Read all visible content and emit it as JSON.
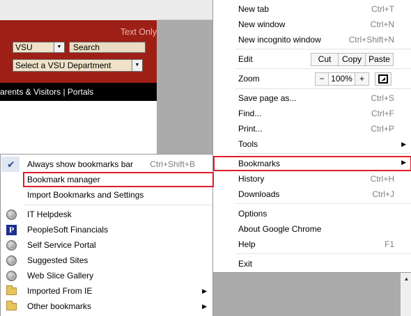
{
  "webpage": {
    "text_only": "Text Only",
    "campus_select": "VSU",
    "search_placeholder": "Search",
    "department_select": "Select a VSU Department",
    "nav_bar": "arents & Visitors | Portals"
  },
  "main_menu": {
    "new_tab": {
      "label": "New tab",
      "shortcut": "Ctrl+T"
    },
    "new_window": {
      "label": "New window",
      "shortcut": "Ctrl+N"
    },
    "new_incognito": {
      "label": "New incognito window",
      "shortcut": "Ctrl+Shift+N"
    },
    "edit": {
      "label": "Edit",
      "cut": "Cut",
      "copy": "Copy",
      "paste": "Paste"
    },
    "zoom": {
      "label": "Zoom",
      "minus": "−",
      "level": "100%",
      "plus": "+",
      "fullscreen_icon": "fullscreen-icon"
    },
    "save_page": {
      "label": "Save page as...",
      "shortcut": "Ctrl+S"
    },
    "find": {
      "label": "Find...",
      "shortcut": "Ctrl+F"
    },
    "print": {
      "label": "Print...",
      "shortcut": "Ctrl+P"
    },
    "tools": {
      "label": "Tools"
    },
    "bookmarks": {
      "label": "Bookmarks"
    },
    "history": {
      "label": "History",
      "shortcut": "Ctrl+H"
    },
    "downloads": {
      "label": "Downloads",
      "shortcut": "Ctrl+J"
    },
    "options": {
      "label": "Options"
    },
    "about": {
      "label": "About Google Chrome"
    },
    "help": {
      "label": "Help",
      "shortcut": "F1"
    },
    "exit": {
      "label": "Exit"
    }
  },
  "bookmarks_menu": {
    "always_show": {
      "label": "Always show bookmarks bar",
      "shortcut": "Ctrl+Shift+B",
      "checked": true
    },
    "manager": {
      "label": "Bookmark manager"
    },
    "import": {
      "label": "Import Bookmarks and Settings"
    },
    "items": [
      {
        "label": "IT Helpdesk",
        "icon": "globe-icon"
      },
      {
        "label": "PeopleSoft Financials",
        "icon": "peoplesoft-icon"
      },
      {
        "label": "Self Service Portal",
        "icon": "globe-icon"
      },
      {
        "label": "Suggested Sites",
        "icon": "globe-icon"
      },
      {
        "label": "Web Slice Gallery",
        "icon": "globe-icon"
      },
      {
        "label": "Imported From IE",
        "icon": "folder-icon"
      },
      {
        "label": "Other bookmarks",
        "icon": "folder-icon"
      }
    ]
  },
  "colors": {
    "highlight_border": "#e01a28",
    "vsu_red": "#9e1f16"
  }
}
